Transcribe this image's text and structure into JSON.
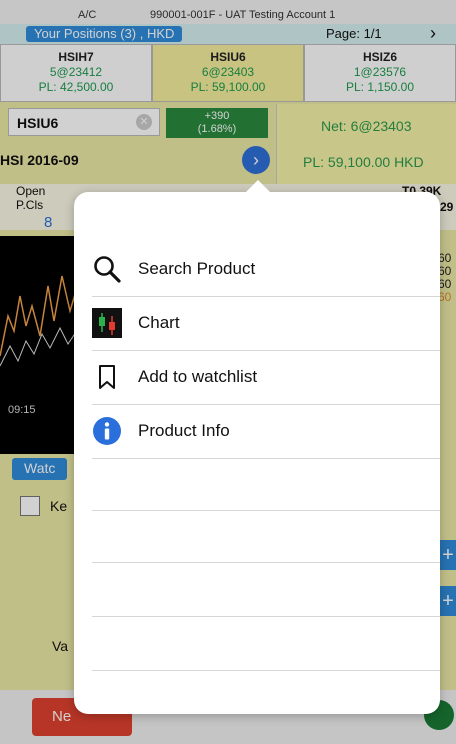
{
  "account": {
    "label": "A/C",
    "value": "990001-001F - UAT Testing Account 1"
  },
  "positions_bar": {
    "title": "Your Positions (3) , HKD",
    "page": "Page: 1/1",
    "next_icon": "chevron-right-icon"
  },
  "positions": [
    {
      "code": "HSIH7",
      "qty": "5@23412",
      "pl": "PL: 42,500.00"
    },
    {
      "code": "HSIU6",
      "qty": "6@23403",
      "pl": "PL: 59,100.00"
    },
    {
      "code": "HSIZ6",
      "qty": "1@23576",
      "pl": "PL: 1,150.00"
    }
  ],
  "product": {
    "code": "HSIU6",
    "change": "+390",
    "change_pct": "(1.68%)",
    "series": "HSI 2016-09",
    "net": "Net: 6@23403",
    "pl": "PL: 59,100.00 HKD"
  },
  "stats": {
    "open_label": "Open",
    "pcls_label": "P.Cls",
    "partial_value": "8",
    "vol_label": "T0.39K",
    "partial_right": "29"
  },
  "chart_time": "09:15",
  "right_partial": [
    "60",
    "60",
    "60",
    "60"
  ],
  "watch_tab": "Watc",
  "keep_label": "Ke",
  "va_label": "Va",
  "bottom": {
    "new_label": "Ne"
  },
  "menu": {
    "items": [
      {
        "label": "Search Product",
        "icon": "search-icon"
      },
      {
        "label": "Chart",
        "icon": "chart-icon"
      },
      {
        "label": "Add to watchlist",
        "icon": "bookmark-icon"
      },
      {
        "label": "Product Info",
        "icon": "info-icon"
      }
    ]
  },
  "colors": {
    "accent_blue": "#2f8cd9",
    "profit_green": "#1d9a4d",
    "panel_yellow": "#f4ee9e",
    "change_green": "#2a8a3f"
  }
}
